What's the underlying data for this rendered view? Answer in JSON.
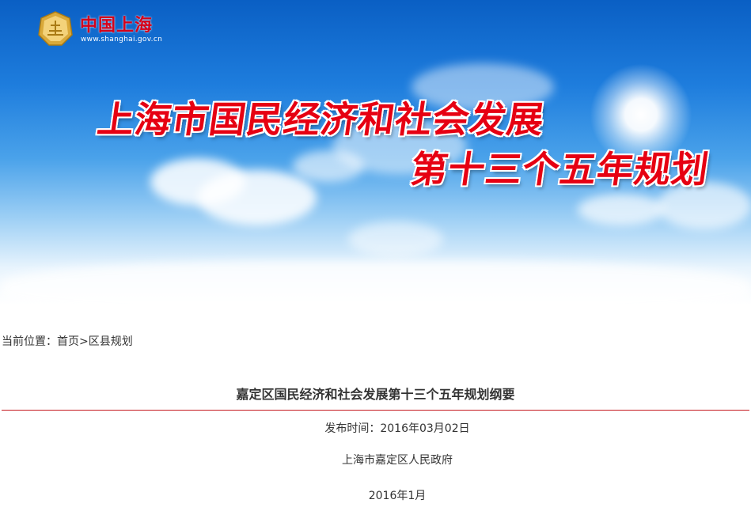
{
  "header": {
    "logo_text": "中国上海",
    "logo_url": "www.shanghai.gov.cn",
    "banner_title_line1": "上海市国民经济和社会发展",
    "banner_title_line2": "第十三个五年规划"
  },
  "breadcrumb": {
    "prefix": "当前位置：",
    "items": [
      {
        "label": "首页"
      },
      {
        "label": "区县规划"
      }
    ],
    "separator": ">"
  },
  "article": {
    "title": "嘉定区国民经济和社会发展第十三个五年规划纲要",
    "publish_time": "发布时间：2016年03月02日",
    "organization": "上海市嘉定区人民政府",
    "date": "2016年1月"
  },
  "colors": {
    "banner_title": "#e60012",
    "logo_text": "#d4001a",
    "divider": "#c4161c",
    "sky_top": "#0a5fc4"
  }
}
